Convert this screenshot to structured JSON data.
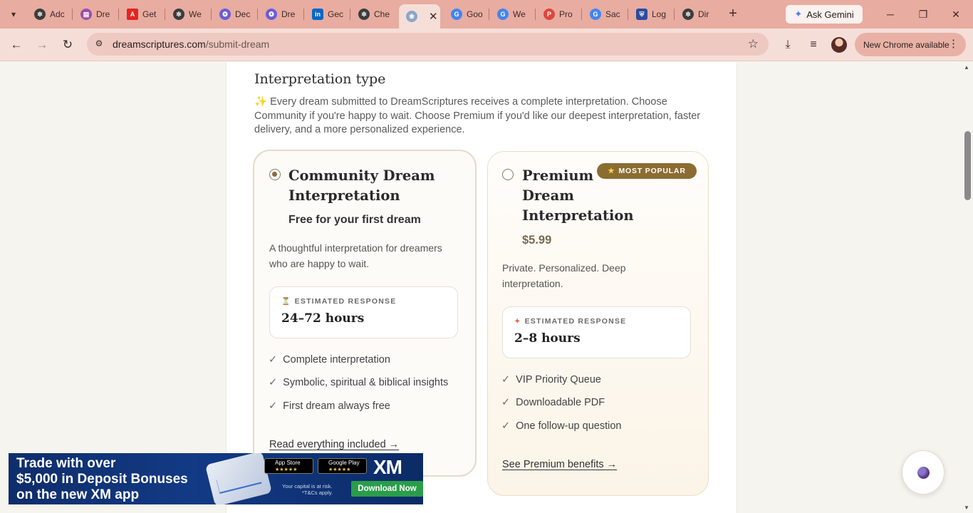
{
  "browser": {
    "tabs": [
      {
        "label": "Adc",
        "favicon": "chatgpt-icon",
        "color": "#3c3c3c"
      },
      {
        "label": "Dre",
        "favicon": "book-icon",
        "color": "#9b4fa8"
      },
      {
        "label": "Get",
        "favicon": "adobe-icon",
        "color": "#e5251f"
      },
      {
        "label": "We",
        "favicon": "chatgpt-icon",
        "color": "#3c3c3c"
      },
      {
        "label": "Dec",
        "favicon": "swirl-icon",
        "color": "#6a5cd8"
      },
      {
        "label": "Dre",
        "favicon": "swirl-icon",
        "color": "#6a5cd8"
      },
      {
        "label": "Gec",
        "favicon": "linkedin-icon",
        "color": "#0a66c2"
      },
      {
        "label": "Che",
        "favicon": "chatgpt-icon",
        "color": "#3c3c3c"
      },
      {
        "label": "",
        "favicon": "lily-icon",
        "color": "#8aa6c8",
        "active": true
      },
      {
        "label": "Goo",
        "favicon": "google-icon",
        "color": "#4285f4"
      },
      {
        "label": "We",
        "favicon": "google-icon",
        "color": "#4285f4"
      },
      {
        "label": "Pro",
        "favicon": "producthunt-icon",
        "color": "#e0463a"
      },
      {
        "label": "Sac",
        "favicon": "google-icon",
        "color": "#4285f4"
      },
      {
        "label": "Log",
        "favicon": "shield-icon",
        "color": "#2d4ba0"
      },
      {
        "label": "Dir",
        "favicon": "chatgpt-icon",
        "color": "#3c3c3c"
      }
    ],
    "ask_gemini": "Ask Gemini",
    "url_domain": "dreamscriptures.com",
    "url_path": "/submit-dream",
    "new_chrome": "New Chrome available"
  },
  "section": {
    "title": "Interpretation type",
    "intro": "Every dream submitted to DreamScriptures receives a complete interpretation. Choose Community if you're happy to wait. Choose Premium if you'd like our deepest interpretation, faster delivery, and a more personalized experience."
  },
  "plans": {
    "community": {
      "name_line1": "Community Dream",
      "name_line2": "Interpretation",
      "subtitle": "Free for your first dream",
      "desc_line1": "A thoughtful interpretation for dreamers",
      "desc_line2": "who are happy to wait.",
      "response_label": "ESTIMATED RESPONSE",
      "response_value": "24–72 hours",
      "features": [
        "Complete interpretation",
        "Symbolic, spiritual & biblical insights",
        "First dream always free"
      ],
      "link": "Read everything included →",
      "selected": true
    },
    "premium": {
      "name_line1": "Premium",
      "name_line2": "Dream",
      "name_line3": "Interpretation",
      "price": "$5.99",
      "badge": "MOST POPULAR",
      "desc_line1": "Private. Personalized. Deep",
      "desc_line2": "interpretation.",
      "response_label": "ESTIMATED RESPONSE",
      "response_value": "2–8 hours",
      "features": [
        "VIP Priority Queue",
        "Downloadable PDF",
        "One follow-up question"
      ],
      "link": "See Premium benefits →",
      "selected": false
    }
  },
  "ad": {
    "line1": "Trade with over",
    "line2": "$5,000 in Deposit Bonuses",
    "line3": "on the new XM app",
    "app_store": "App Store",
    "google_play": "Google Play",
    "logo": "XM",
    "disclaimer_line1": "Your capital is at risk.",
    "disclaimer_line2": "*T&Cs apply.",
    "cta": "Download Now"
  }
}
